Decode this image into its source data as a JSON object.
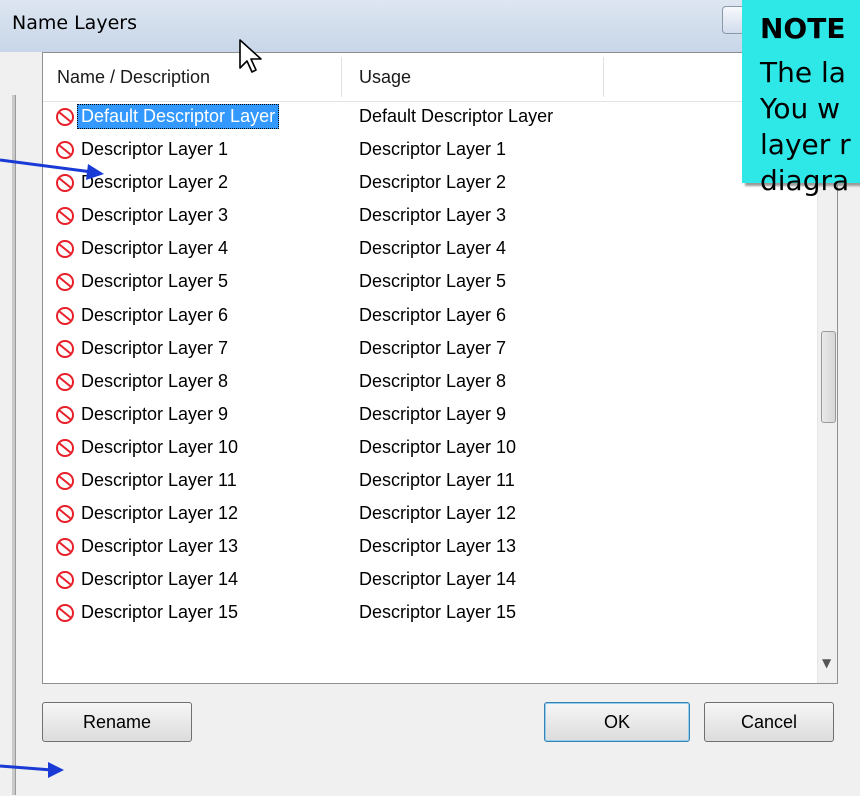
{
  "window": {
    "title": "Name Layers"
  },
  "columns": {
    "name": "Name / Description",
    "usage": "Usage"
  },
  "layers": [
    {
      "name": "Default Descriptor Layer",
      "usage": "Default Descriptor Layer"
    },
    {
      "name": "Descriptor Layer 1",
      "usage": "Descriptor Layer 1"
    },
    {
      "name": "Descriptor Layer 2",
      "usage": "Descriptor Layer 2"
    },
    {
      "name": "Descriptor Layer 3",
      "usage": "Descriptor Layer 3"
    },
    {
      "name": "Descriptor Layer 4",
      "usage": "Descriptor Layer 4"
    },
    {
      "name": "Descriptor Layer 5",
      "usage": "Descriptor Layer 5"
    },
    {
      "name": "Descriptor Layer 6",
      "usage": "Descriptor Layer 6"
    },
    {
      "name": "Descriptor Layer 7",
      "usage": "Descriptor Layer 7"
    },
    {
      "name": "Descriptor Layer 8",
      "usage": "Descriptor Layer 8"
    },
    {
      "name": "Descriptor Layer 9",
      "usage": "Descriptor Layer 9"
    },
    {
      "name": "Descriptor Layer 10",
      "usage": "Descriptor Layer 10"
    },
    {
      "name": "Descriptor Layer 11",
      "usage": "Descriptor Layer 11"
    },
    {
      "name": "Descriptor Layer 12",
      "usage": "Descriptor Layer 12"
    },
    {
      "name": "Descriptor Layer 13",
      "usage": "Descriptor Layer 13"
    },
    {
      "name": "Descriptor Layer 14",
      "usage": "Descriptor Layer 14"
    },
    {
      "name": "Descriptor Layer 15",
      "usage": "Descriptor Layer 15"
    }
  ],
  "selected_index": 0,
  "buttons": {
    "rename": "Rename",
    "ok": "OK",
    "cancel": "Cancel"
  },
  "note": {
    "title": "NOTE",
    "lines": [
      "The la",
      "You w",
      "layer r",
      "diagra"
    ]
  },
  "colors": {
    "selection": "#3399ff",
    "layer_icon": "#e8202a",
    "note_background": "#2ee8e8",
    "annotation_arrow": "#1a3ad6"
  },
  "icons": {
    "layer": "no-entry-icon",
    "cursor": "mouse-pointer-icon"
  }
}
